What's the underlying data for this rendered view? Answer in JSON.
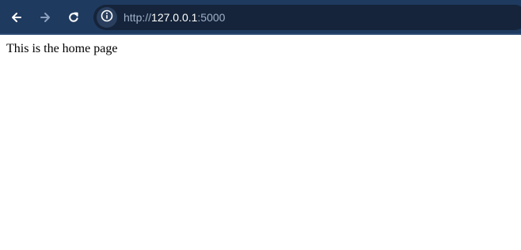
{
  "toolbar": {
    "background": "#1f3a5f",
    "back_icon": "arrow-left-icon",
    "forward_icon": "arrow-right-icon",
    "reload_icon": "reload-icon",
    "site_info_icon": "info-icon"
  },
  "address_bar": {
    "scheme": "http://",
    "host": "127.0.0.1",
    "port": ":5000"
  },
  "page": {
    "text": "This is the home page"
  }
}
